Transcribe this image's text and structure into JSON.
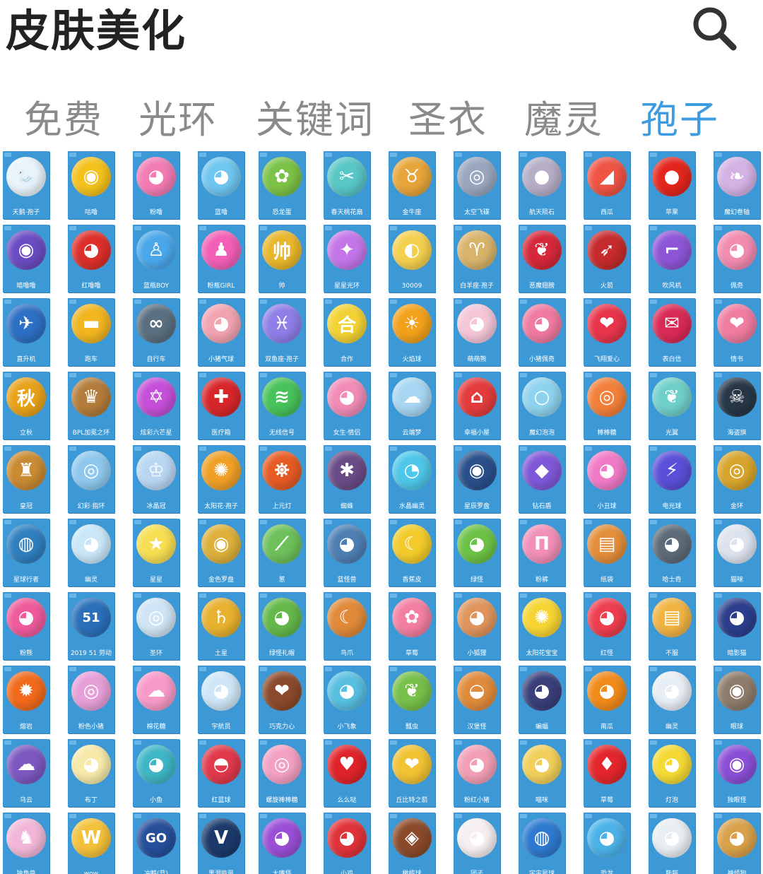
{
  "header": {
    "title": "皮肤美化",
    "search_icon": "search-icon"
  },
  "tabs": [
    {
      "label": "免费",
      "active": false
    },
    {
      "label": "光环",
      "active": false
    },
    {
      "label": "关键词",
      "active": false
    },
    {
      "label": "圣衣",
      "active": false
    },
    {
      "label": "魔灵",
      "active": false
    },
    {
      "label": "孢子",
      "active": true
    }
  ],
  "colors": {
    "accent": "#3d9be0",
    "card_bg": "#3d98d6",
    "tab_inactive": "#8a8a8a"
  },
  "grid": {
    "rows": [
      [
        {
          "label": "天鹅·孢子",
          "icon": "swan-icon",
          "color": "#e9f3fb",
          "glyph": "🦢"
        },
        {
          "label": "咕噜",
          "icon": "yellow-monster-icon",
          "color": "#f4c21b",
          "glyph": "◉"
        },
        {
          "label": "粉噜",
          "icon": "pink-monster-icon",
          "color": "#f27cb3",
          "glyph": "◕"
        },
        {
          "label": "蓝噜",
          "icon": "blue-monster-icon",
          "color": "#6fc6f0",
          "glyph": "◕"
        },
        {
          "label": "恐龙蛋",
          "icon": "green-dino-icon",
          "color": "#7cc246",
          "glyph": "✿"
        },
        {
          "label": "春天桃花扇",
          "icon": "fan-icon",
          "color": "#58c7c5",
          "glyph": "✂"
        },
        {
          "label": "金牛座",
          "icon": "gold-horn-icon",
          "color": "#e7a53a",
          "glyph": "♉"
        },
        {
          "label": "太空飞碟",
          "icon": "ufo-icon",
          "color": "#9aa6bd",
          "glyph": "◎"
        },
        {
          "label": "航天陨石",
          "icon": "moon-rock-icon",
          "color": "#b5aec6",
          "glyph": "●"
        },
        {
          "label": "西瓜",
          "icon": "watermelon-icon",
          "color": "#ef5445",
          "glyph": "◢"
        },
        {
          "label": "苹果",
          "icon": "apple-icon",
          "color": "#e3261d",
          "glyph": "●"
        },
        {
          "label": "魔幻卷轴",
          "icon": "scroll-icon",
          "color": "#d4b2e3",
          "glyph": "❧"
        }
      ],
      [
        {
          "label": "暗噜噜",
          "icon": "purple-eye-icon",
          "color": "#6a4cc2",
          "glyph": "◉"
        },
        {
          "label": "红噜噜",
          "icon": "red-monster-icon",
          "color": "#dd2f2a",
          "glyph": "◕"
        },
        {
          "label": "蓝瓶BOY",
          "icon": "blue-bottle-icon",
          "color": "#4aa7ea",
          "glyph": "♙"
        },
        {
          "label": "粉瓶GIRL",
          "icon": "pink-bottle-icon",
          "color": "#f35fb6",
          "glyph": "♟"
        },
        {
          "label": "帅",
          "icon": "shuai-text-icon",
          "color": "#e9b72b",
          "glyph": "帅"
        },
        {
          "label": "星星光环",
          "icon": "star-ring-icon",
          "color": "#c476e8",
          "glyph": "✦"
        },
        {
          "label": "30009",
          "icon": "headphone-icon",
          "color": "#f4d04f",
          "glyph": "◐"
        },
        {
          "label": "白羊座·孢子",
          "icon": "ram-icon",
          "color": "#d8b36a",
          "glyph": "♈"
        },
        {
          "label": "恶魔翅膀",
          "icon": "devil-wing-icon",
          "color": "#d5283a",
          "glyph": "❦"
        },
        {
          "label": "火箭",
          "icon": "rocket-icon",
          "color": "#c52b2c",
          "glyph": "➶"
        },
        {
          "label": "吹风机",
          "icon": "hairdryer-icon",
          "color": "#8d56d6",
          "glyph": "⌐"
        },
        {
          "label": "佩奇",
          "icon": "pig-icon",
          "color": "#f28bb0",
          "glyph": "◕"
        }
      ],
      [
        {
          "label": "直升机",
          "icon": "helicopter-icon",
          "color": "#2d6fc3",
          "glyph": "✈"
        },
        {
          "label": "跑车",
          "icon": "sports-car-icon",
          "color": "#f1b51f",
          "glyph": "▬"
        },
        {
          "label": "自行车",
          "icon": "bicycle-icon",
          "color": "#5a6f7f",
          "glyph": "∞"
        },
        {
          "label": "小猪气球",
          "icon": "pig-balloon-icon",
          "color": "#f2a3b0",
          "glyph": "◕"
        },
        {
          "label": "双鱼座·孢子",
          "icon": "pisces-icon",
          "color": "#8f7ee8",
          "glyph": "♓"
        },
        {
          "label": "合作",
          "icon": "hezuo-text-icon",
          "color": "#f2d233",
          "glyph": "合"
        },
        {
          "label": "火焰球",
          "icon": "sun-ball-icon",
          "color": "#f2a11a",
          "glyph": "☀"
        },
        {
          "label": "萌萌熊",
          "icon": "bear-icon",
          "color": "#f4c6d8",
          "glyph": "◕"
        },
        {
          "label": "小猪佩奇",
          "icon": "pink-pig-icon",
          "color": "#f07aa0",
          "glyph": "◕"
        },
        {
          "label": "飞翔爱心",
          "icon": "winged-heart-icon",
          "color": "#e8354b",
          "glyph": "❤"
        },
        {
          "label": "表白信",
          "icon": "love-letter-icon",
          "color": "#d92a56",
          "glyph": "✉"
        },
        {
          "label": "情书",
          "icon": "stamp-icon",
          "color": "#f07ca0",
          "glyph": "❤"
        }
      ],
      [
        {
          "label": "立秋",
          "icon": "qiu-text-icon",
          "color": "#e8a21a",
          "glyph": "秋"
        },
        {
          "label": "BPL加冕之环",
          "icon": "crown-shield-icon",
          "color": "#b37c3a",
          "glyph": "♛"
        },
        {
          "label": "炫彩六芒星",
          "icon": "hexagram-icon",
          "color": "#c54fd8",
          "glyph": "✡"
        },
        {
          "label": "医疗箱",
          "icon": "medkit-icon",
          "color": "#d7262a",
          "glyph": "✚"
        },
        {
          "label": "无线信号",
          "icon": "wifi-icon",
          "color": "#47c25a",
          "glyph": "≋"
        },
        {
          "label": "女生·情侣",
          "icon": "pink-girl-icon",
          "color": "#f08cb6",
          "glyph": "◕"
        },
        {
          "label": "云端梦",
          "icon": "cloud-moon-icon",
          "color": "#a8d6f2",
          "glyph": "☁"
        },
        {
          "label": "幸福小屋",
          "icon": "mushroom-house-icon",
          "color": "#e33c3c",
          "glyph": "⌂"
        },
        {
          "label": "魔幻泡泡",
          "icon": "bubble-icon",
          "color": "#8ed3ee",
          "glyph": "○"
        },
        {
          "label": "棒棒糖",
          "icon": "lollipop-icon",
          "color": "#f2803a",
          "glyph": "◎"
        },
        {
          "label": "光翼",
          "icon": "wing-ball-icon",
          "color": "#6fd0c9",
          "glyph": "❦"
        },
        {
          "label": "海盗旗",
          "icon": "pirate-flag-icon",
          "color": "#273746",
          "glyph": "☠"
        }
      ],
      [
        {
          "label": "皇冠",
          "icon": "crown-icon",
          "color": "#c98a32",
          "glyph": "♜"
        },
        {
          "label": "幻彩·指环",
          "icon": "ring-icon",
          "color": "#8fc8ee",
          "glyph": "◎"
        },
        {
          "label": "冰晶冠",
          "icon": "tiara-icon",
          "color": "#b9d7f2",
          "glyph": "♔"
        },
        {
          "label": "太阳花·孢子",
          "icon": "sunflower-icon",
          "color": "#f0a027",
          "glyph": "✺"
        },
        {
          "label": "上元灯",
          "icon": "lantern-icon",
          "color": "#e55b24",
          "glyph": "⛯"
        },
        {
          "label": "蜘蛛",
          "icon": "spider-icon",
          "color": "#6a4b86",
          "glyph": "✱"
        },
        {
          "label": "水晶幽灵",
          "icon": "jelly-icon",
          "color": "#4ec7ea",
          "glyph": "◔"
        },
        {
          "label": "星辰罗盘",
          "icon": "compass-icon",
          "color": "#2a4f8b",
          "glyph": "◉"
        },
        {
          "label": "钻石盾",
          "icon": "gem-shield-icon",
          "color": "#7f58d8",
          "glyph": "◆"
        },
        {
          "label": "小丑球",
          "icon": "clown-ball-icon",
          "color": "#f07ac6",
          "glyph": "◕"
        },
        {
          "label": "电光球",
          "icon": "lightning-icon",
          "color": "#5a4fd8",
          "glyph": "⚡"
        },
        {
          "label": "金环",
          "icon": "gold-ring-icon",
          "color": "#d8a52c",
          "glyph": "◎"
        }
      ],
      [
        {
          "label": "星球行者",
          "icon": "planet-icon",
          "color": "#2f7fbf",
          "glyph": "◍"
        },
        {
          "label": "幽灵",
          "icon": "ghost-icon",
          "color": "#c9e7f7",
          "glyph": "◕"
        },
        {
          "label": "星星",
          "icon": "star-icon",
          "color": "#f7de52",
          "glyph": "★"
        },
        {
          "label": "金色罗盘",
          "icon": "gold-disc-icon",
          "color": "#dcb03a",
          "glyph": "◉"
        },
        {
          "label": "葱",
          "icon": "leek-icon",
          "color": "#6ec05a",
          "glyph": "⟋"
        },
        {
          "label": "蓝怪兽",
          "icon": "blue-monster-face-icon",
          "color": "#4e7fb3",
          "glyph": "◕"
        },
        {
          "label": "香蕉皮",
          "icon": "banana-icon",
          "color": "#f2cb2a",
          "glyph": "☾"
        },
        {
          "label": "绿怪",
          "icon": "green-monster-icon",
          "color": "#6cc246",
          "glyph": "◕"
        },
        {
          "label": "粉裤",
          "icon": "pink-pants-icon",
          "color": "#f28fb8",
          "glyph": "Π"
        },
        {
          "label": "纸袋",
          "icon": "paper-bag-icon",
          "color": "#e38e3a",
          "glyph": "▤"
        },
        {
          "label": "哈士奇",
          "icon": "husky-icon",
          "color": "#5d6b78",
          "glyph": "◕"
        },
        {
          "label": "猫咪",
          "icon": "white-cat-icon",
          "color": "#dde3ee",
          "glyph": "◕"
        }
      ],
      [
        {
          "label": "粉熊",
          "icon": "pink-bear-icon",
          "color": "#ef5b9b",
          "glyph": "◕"
        },
        {
          "label": "2019 51 劳动",
          "icon": "text-51-icon",
          "color": "#2a6fb9",
          "glyph": "51"
        },
        {
          "label": "圣环",
          "icon": "holy-ring-icon",
          "color": "#cfe4f4",
          "glyph": "◎"
        },
        {
          "label": "土星",
          "icon": "saturn-icon",
          "color": "#e8b12e",
          "glyph": "♄"
        },
        {
          "label": "绿怪礼帽",
          "icon": "hat-monster-icon",
          "color": "#64b84a",
          "glyph": "◕"
        },
        {
          "label": "鸟爪",
          "icon": "claw-icon",
          "color": "#e08a3a",
          "glyph": "☾"
        },
        {
          "label": "草莓",
          "icon": "pink-knot-icon",
          "color": "#f27fa2",
          "glyph": "✿"
        },
        {
          "label": "小狐狸",
          "icon": "fox-icon",
          "color": "#e0955c",
          "glyph": "◕"
        },
        {
          "label": "太阳花宝宝",
          "icon": "sun-face-icon",
          "color": "#f6d533",
          "glyph": "✺"
        },
        {
          "label": "红怪",
          "icon": "red-ghost-icon",
          "color": "#ee3e4f",
          "glyph": "◕"
        },
        {
          "label": "不服",
          "icon": "note-icon",
          "color": "#f0b443",
          "glyph": "▤"
        },
        {
          "label": "暗影猫",
          "icon": "dark-cat-icon",
          "color": "#2c3e8c",
          "glyph": "◕"
        }
      ],
      [
        {
          "label": "熔岩",
          "icon": "lava-icon",
          "color": "#f16a1b",
          "glyph": "✹"
        },
        {
          "label": "粉色小猪",
          "icon": "pink-disc-icon",
          "color": "#e79fd8",
          "glyph": "◎"
        },
        {
          "label": "棉花糖",
          "icon": "cotton-candy-icon",
          "color": "#f79ac7",
          "glyph": "☁"
        },
        {
          "label": "宇航员",
          "icon": "astronaut-icon",
          "color": "#cfe6f6",
          "glyph": "◕"
        },
        {
          "label": "巧克力心",
          "icon": "choco-heart-icon",
          "color": "#8b4a2b",
          "glyph": "❤"
        },
        {
          "label": "小飞象",
          "icon": "elephant-icon",
          "color": "#58bfe0",
          "glyph": "◕"
        },
        {
          "label": "瓢虫",
          "icon": "leaf-bug-icon",
          "color": "#77c04a",
          "glyph": "❦"
        },
        {
          "label": "汉堡怪",
          "icon": "burger-icon",
          "color": "#e08b3c",
          "glyph": "◒"
        },
        {
          "label": "蝙蝠",
          "icon": "bat-icon",
          "color": "#3a3f7a",
          "glyph": "◕"
        },
        {
          "label": "南瓜",
          "icon": "pumpkin-icon",
          "color": "#f08a1a",
          "glyph": "◕"
        },
        {
          "label": "幽灵",
          "icon": "white-ghost-icon",
          "color": "#e7eef4",
          "glyph": "◕"
        },
        {
          "label": "眼球",
          "icon": "eyeball-icon",
          "color": "#8d7c6b",
          "glyph": "◉"
        }
      ],
      [
        {
          "label": "乌云",
          "icon": "storm-cloud-icon",
          "color": "#7c58c0",
          "glyph": "☁"
        },
        {
          "label": "布丁",
          "icon": "pudding-icon",
          "color": "#f7e9a8",
          "glyph": "◕"
        },
        {
          "label": "小鱼",
          "icon": "fish-icon",
          "color": "#3fb6c5",
          "glyph": "◕"
        },
        {
          "label": "红蓝球",
          "icon": "pokeball-icon",
          "color": "#e0394b",
          "glyph": "◓"
        },
        {
          "label": "螺旋棒棒糖",
          "icon": "swirl-candy-icon",
          "color": "#f3a0c2",
          "glyph": "◎"
        },
        {
          "label": "么么哒",
          "icon": "kiss-lips-icon",
          "color": "#e0232a",
          "glyph": "♥"
        },
        {
          "label": "丘比特之箭",
          "icon": "cupid-heart-icon",
          "color": "#f1c232",
          "glyph": "❤"
        },
        {
          "label": "粉红小猪",
          "icon": "pink-cat-icon",
          "color": "#f29fb5",
          "glyph": "◕"
        },
        {
          "label": "喵咪",
          "icon": "yellow-cat-icon",
          "color": "#f2cf5a",
          "glyph": "◕"
        },
        {
          "label": "草莓",
          "icon": "strawberry-icon",
          "color": "#e3262c",
          "glyph": "♦"
        },
        {
          "label": "灯泡",
          "icon": "lightbulb-icon",
          "color": "#f5d934",
          "glyph": "◕"
        },
        {
          "label": "独眼怪",
          "icon": "one-eye-icon",
          "color": "#8a4fd6",
          "glyph": "◉"
        }
      ],
      [
        {
          "label": "独角兽",
          "icon": "unicorn-icon",
          "color": "#f2b7d8",
          "glyph": "♞"
        },
        {
          "label": "wow",
          "icon": "wow-icon",
          "color": "#f4c13a",
          "glyph": "W"
        },
        {
          "label": "冲鸭(蓝)",
          "icon": "go-icon",
          "color": "#264f9a",
          "glyph": "GO"
        },
        {
          "label": "黑洞能量",
          "icon": "v-logo-icon",
          "color": "#1b3a6b",
          "glyph": "V"
        },
        {
          "label": "大嘴怪",
          "icon": "big-mouth-icon",
          "color": "#9a4fd6",
          "glyph": "◕"
        },
        {
          "label": "小鸡",
          "icon": "chick-icon",
          "color": "#e0333a",
          "glyph": "◕"
        },
        {
          "label": "橄榄球",
          "icon": "football-icon",
          "color": "#8a4a2a",
          "glyph": "◈"
        },
        {
          "label": "团子",
          "icon": "dumpling-icon",
          "color": "#f6eef0",
          "glyph": "◕"
        },
        {
          "label": "宇宙星球",
          "icon": "galaxy-icon",
          "color": "#2e7ad0",
          "glyph": "◍"
        },
        {
          "label": "恐龙",
          "icon": "blue-dino-icon",
          "color": "#4bb2e8",
          "glyph": "◕"
        },
        {
          "label": "熊猫",
          "icon": "panda-icon",
          "color": "#e8eef2",
          "glyph": "◕"
        },
        {
          "label": "神烦狗",
          "icon": "doge-icon",
          "color": "#d9a14a",
          "glyph": "◕"
        }
      ]
    ]
  }
}
